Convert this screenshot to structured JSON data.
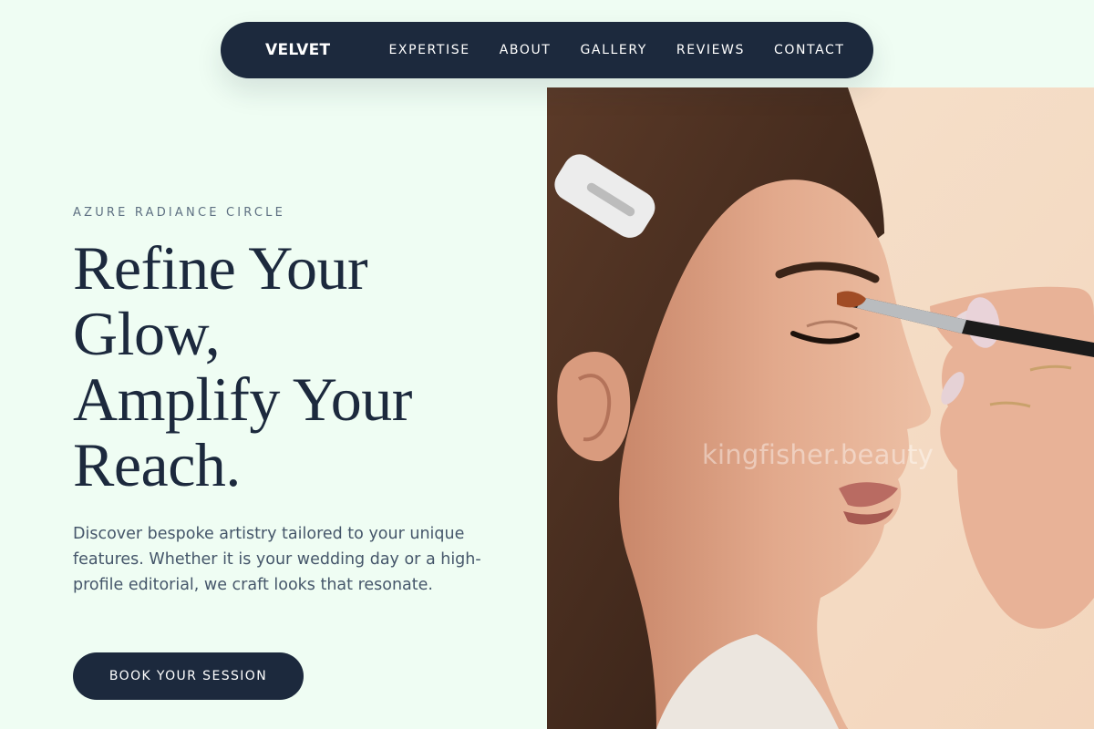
{
  "nav": {
    "brand": "VELVET",
    "links": [
      "EXPERTISE",
      "ABOUT",
      "GALLERY",
      "REVIEWS",
      "CONTACT"
    ]
  },
  "hero": {
    "eyebrow": "AZURE RADIANCE CIRCLE",
    "headline_lines": [
      "Refine Your",
      "Glow,",
      "Amplify Your",
      "Reach."
    ],
    "description": "Discover bespoke artistry tailored to your unique features. Whether it is your wedding day or a high-profile editorial, we craft looks that resonate.",
    "cta_label": "BOOK YOUR SESSION"
  },
  "image": {
    "watermark": "kingfisher.beauty"
  },
  "colors": {
    "background": "#effdf3",
    "navy": "#1c293d",
    "muted_text": "#45566a"
  }
}
